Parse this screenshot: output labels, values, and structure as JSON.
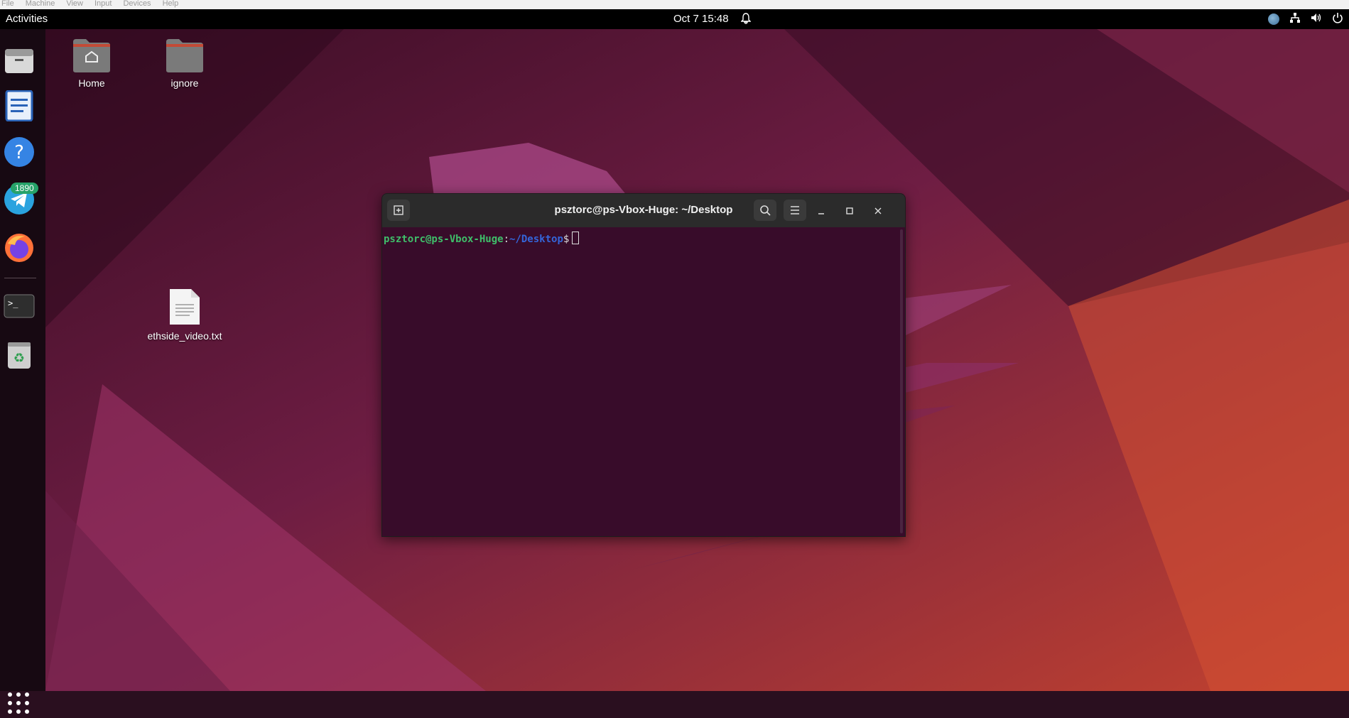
{
  "vbox_menu": [
    "File",
    "Machine",
    "View",
    "Input",
    "Devices",
    "Help"
  ],
  "topbar": {
    "activities": "Activities",
    "clock": "Oct 7  15:48",
    "tray_icons": [
      "vm-status-icon",
      "network-icon",
      "volume-icon",
      "power-icon"
    ]
  },
  "dock": {
    "apps": [
      "files-app-icon",
      "libreoffice-writer-icon",
      "help-icon",
      "telegram-icon",
      "firefox-icon",
      "terminal-icon",
      "trash-icon"
    ],
    "telegram_badge": "1890"
  },
  "desktop": {
    "icons": [
      {
        "label": "Home"
      },
      {
        "label": "ignore"
      },
      {
        "label": "ethside_video.txt"
      }
    ]
  },
  "terminal": {
    "title": "psztorc@ps-Vbox-Huge: ~/Desktop",
    "prompt_user": "psztorc@ps-Vbox-Huge",
    "prompt_sep": ":",
    "prompt_path": "~/Desktop",
    "prompt_symbol": "$"
  },
  "colors": {
    "terminal_bg": "#380c2a",
    "prompt_user": "#3fbf6a",
    "prompt_path": "#3465d9",
    "badge": "#26a269"
  }
}
